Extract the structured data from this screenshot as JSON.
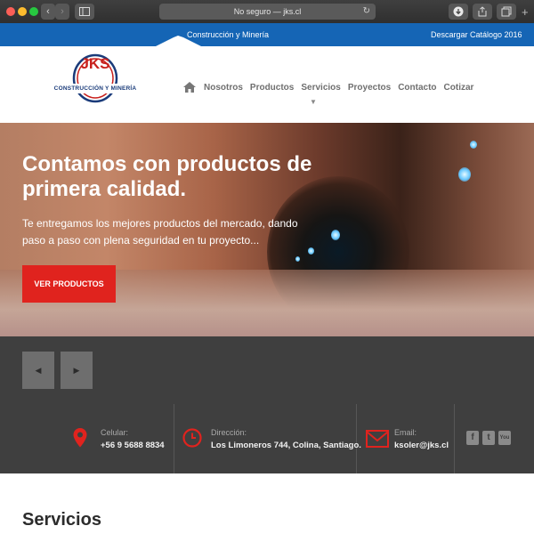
{
  "browser": {
    "address": "No seguro — jks.cl"
  },
  "topbar": {
    "left_link": "Construcción y Minería",
    "right_link": "Descargar Catálogo 2016"
  },
  "logo": {
    "letters": "JKS",
    "tagline": "CONSTRUCCIÓN Y MINERÍA"
  },
  "nav": {
    "items": [
      {
        "label": "Nosotros"
      },
      {
        "label": "Productos"
      },
      {
        "label": "Servicios"
      },
      {
        "label": "Proyectos"
      },
      {
        "label": "Contacto"
      },
      {
        "label": "Cotizar"
      }
    ]
  },
  "hero": {
    "title": "Contamos con productos de primera calidad.",
    "subtitle": "Te entregamos los mejores productos del mercado, dando paso a paso con plena seguridad en tu proyecto...",
    "cta": "VER PRODUCTOS"
  },
  "slider": {
    "prev_icon": "◀",
    "next_icon": "▶"
  },
  "contact": {
    "phone_label": "Celular:",
    "phone_value": "+56 9 5688 8834",
    "address_label": "Dirección:",
    "address_value": "Los Limoneros 744, Colina, Santiago.",
    "email_label": "Email:",
    "email_value": "ksoler@jks.cl"
  },
  "social": {
    "facebook": "f",
    "twitter": "t",
    "youtube": "You"
  },
  "sections": {
    "servicios_title": "Servicios"
  },
  "colors": {
    "brand_blue": "#1565b5",
    "accent_red": "#e0231e",
    "dark_band": "#3f3f3f"
  }
}
